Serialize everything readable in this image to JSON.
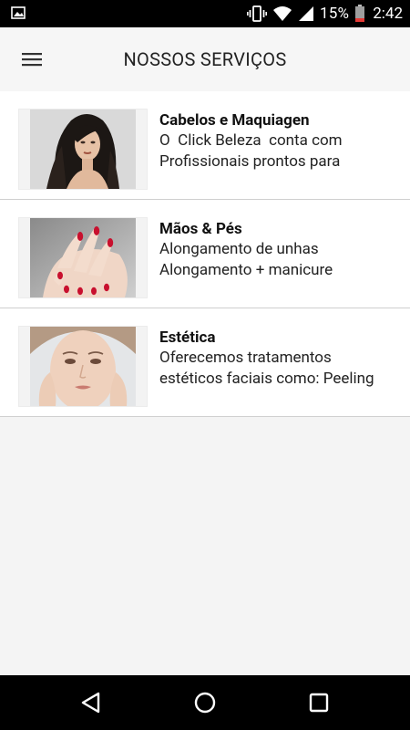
{
  "status_bar": {
    "battery_percent": "15%",
    "time": "2:42",
    "icons": [
      "image-icon",
      "vibrate-icon",
      "wifi-icon",
      "signal-icon",
      "battery-icon"
    ]
  },
  "app_bar": {
    "title": "NOSSOS SERVIÇOS",
    "menu_icon": "hamburger-menu-icon"
  },
  "services": [
    {
      "title": "Cabelos e Maquiagen",
      "line1": "O  Click Beleza  conta com",
      "line2": "Profissionais prontos para",
      "image": "woman-long-hair"
    },
    {
      "title": "Mãos & Pés",
      "line1": "Alongamento de unhas",
      "line2": "Alongamento + manicure",
      "image": "hands-red-nails"
    },
    {
      "title": "Estética",
      "line1": "Oferecemos tratamentos",
      "line2": "estéticos faciais como: Peeling",
      "image": "woman-face-skincare"
    }
  ],
  "nav_bar": {
    "buttons": [
      "back-icon",
      "home-icon",
      "recents-icon"
    ]
  },
  "colors": {
    "status_bar": "#000000",
    "app_bar": "#f6f6f6",
    "list_background": "#ffffff",
    "page_background": "#f4f4f4",
    "nail_red": "#c8102e"
  }
}
